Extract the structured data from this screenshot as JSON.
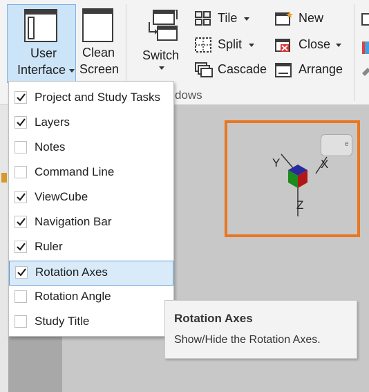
{
  "ribbon": {
    "user_interface": {
      "line1": "User",
      "line2": "Interface"
    },
    "clean_screen": {
      "line1": "Clean",
      "line2": "Screen"
    },
    "switch": {
      "label": "Switch"
    },
    "tile": {
      "label": "Tile"
    },
    "split": {
      "label": "Split"
    },
    "cascade": {
      "label": "Cascade"
    },
    "new": {
      "label": "New"
    },
    "close": {
      "label": "Close"
    },
    "arrange": {
      "label": "Arrange"
    },
    "panel_label": "dows"
  },
  "menu": {
    "items": [
      {
        "label": "Project and Study Tasks",
        "checked": true
      },
      {
        "label": "Layers",
        "checked": true
      },
      {
        "label": "Notes",
        "checked": false
      },
      {
        "label": "Command Line",
        "checked": false
      },
      {
        "label": "ViewCube",
        "checked": true
      },
      {
        "label": "Navigation Bar",
        "checked": true
      },
      {
        "label": "Ruler",
        "checked": true
      },
      {
        "label": "Rotation Axes",
        "checked": true,
        "selected": true
      },
      {
        "label": "Rotation Angle",
        "checked": false
      },
      {
        "label": "Study Title",
        "checked": false
      }
    ]
  },
  "axes": {
    "x": "X",
    "y": "Y",
    "z": "Z"
  },
  "tooltip": {
    "title": "Rotation Axes",
    "description": "Show/Hide the Rotation Axes."
  },
  "colors": {
    "highlight_border": "#e87722",
    "selected_bg": "#d9ebf9",
    "selected_border": "#5d9ad6",
    "check": "#1e1e1e"
  }
}
